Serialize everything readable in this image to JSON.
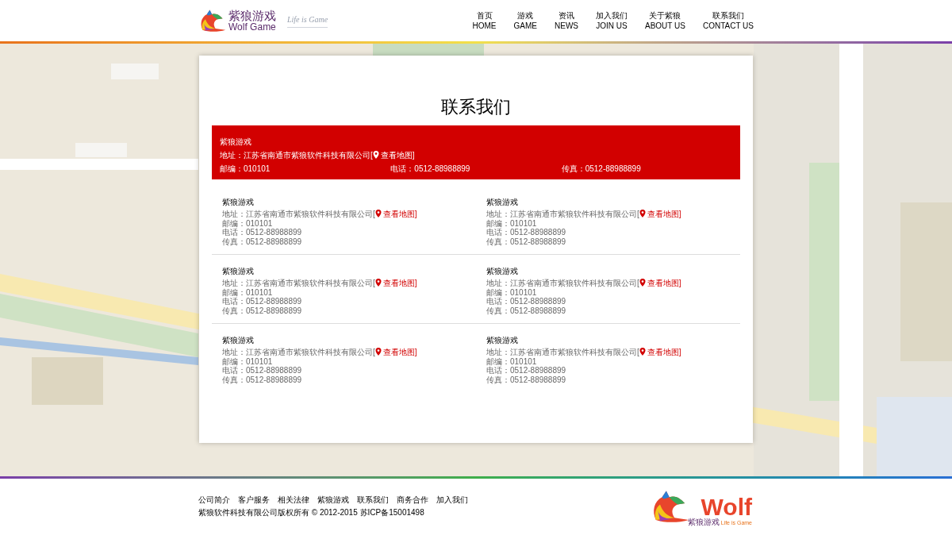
{
  "header": {
    "logo": {
      "name_cn": "紫狼游戏",
      "name_en": "Wolf Game",
      "slogan": "Life is Game"
    },
    "nav": [
      {
        "cn": "首页",
        "en": "HOME"
      },
      {
        "cn": "游戏",
        "en": "GAME"
      },
      {
        "cn": "资讯",
        "en": "NEWS"
      },
      {
        "cn": "加入我们",
        "en": "JOIN US"
      },
      {
        "cn": "关于紫狼",
        "en": "ABOUT US"
      },
      {
        "cn": "联系我们",
        "en": "CONTACT US"
      }
    ]
  },
  "page_title": "联系我们",
  "main_office": {
    "name": "紫狼游戏",
    "address": "地址：江苏省南通市紫狼软件科技有限公司[",
    "map_link": "查看地图]",
    "postcode": "邮编：010101",
    "phone": "电话：0512-88988899",
    "fax": "传真：0512-88988899"
  },
  "branches": [
    {
      "name": "紫狼游戏",
      "address": "地址：江苏省南通市紫狼软件科技有限公司[",
      "map_link": "查看地图]",
      "postcode": "邮编：010101",
      "phone": "电话：0512-88988899",
      "fax": "传真：0512-88988899"
    },
    {
      "name": "紫狼游戏",
      "address": "地址：江苏省南通市紫狼软件科技有限公司[",
      "map_link": "查看地图]",
      "postcode": "邮编：010101",
      "phone": "电话：0512-88988899",
      "fax": "传真：0512-88988899"
    },
    {
      "name": "紫狼游戏",
      "address": "地址：江苏省南通市紫狼软件科技有限公司[",
      "map_link": "查看地图]",
      "postcode": "邮编：010101",
      "phone": "电话：0512-88988899",
      "fax": "传真：0512-88988899"
    },
    {
      "name": "紫狼游戏",
      "address": "地址：江苏省南通市紫狼软件科技有限公司[",
      "map_link": "查看地图]",
      "postcode": "邮编：010101",
      "phone": "电话：0512-88988899",
      "fax": "传真：0512-88988899"
    },
    {
      "name": "紫狼游戏",
      "address": "地址：江苏省南通市紫狼软件科技有限公司[",
      "map_link": "查看地图]",
      "postcode": "邮编：010101",
      "phone": "电话：0512-88988899",
      "fax": "传真：0512-88988899"
    },
    {
      "name": "紫狼游戏",
      "address": "地址：江苏省南通市紫狼软件科技有限公司[",
      "map_link": "查看地图]",
      "postcode": "邮编：010101",
      "phone": "电话：0512-88988899",
      "fax": "传真：0512-88988899"
    }
  ],
  "footer": {
    "links": [
      "公司简介",
      "客户服务",
      "相关法律",
      "紫狼游戏",
      "联系我们",
      "商务合作",
      "加入我们"
    ],
    "copyright": "紫狼软件科技有限公司版权所有 © 2012-2015 苏ICP备15001498",
    "logo": {
      "word": "Wolf",
      "name_cn": "紫狼游戏",
      "slogan": "Life is Game"
    }
  }
}
